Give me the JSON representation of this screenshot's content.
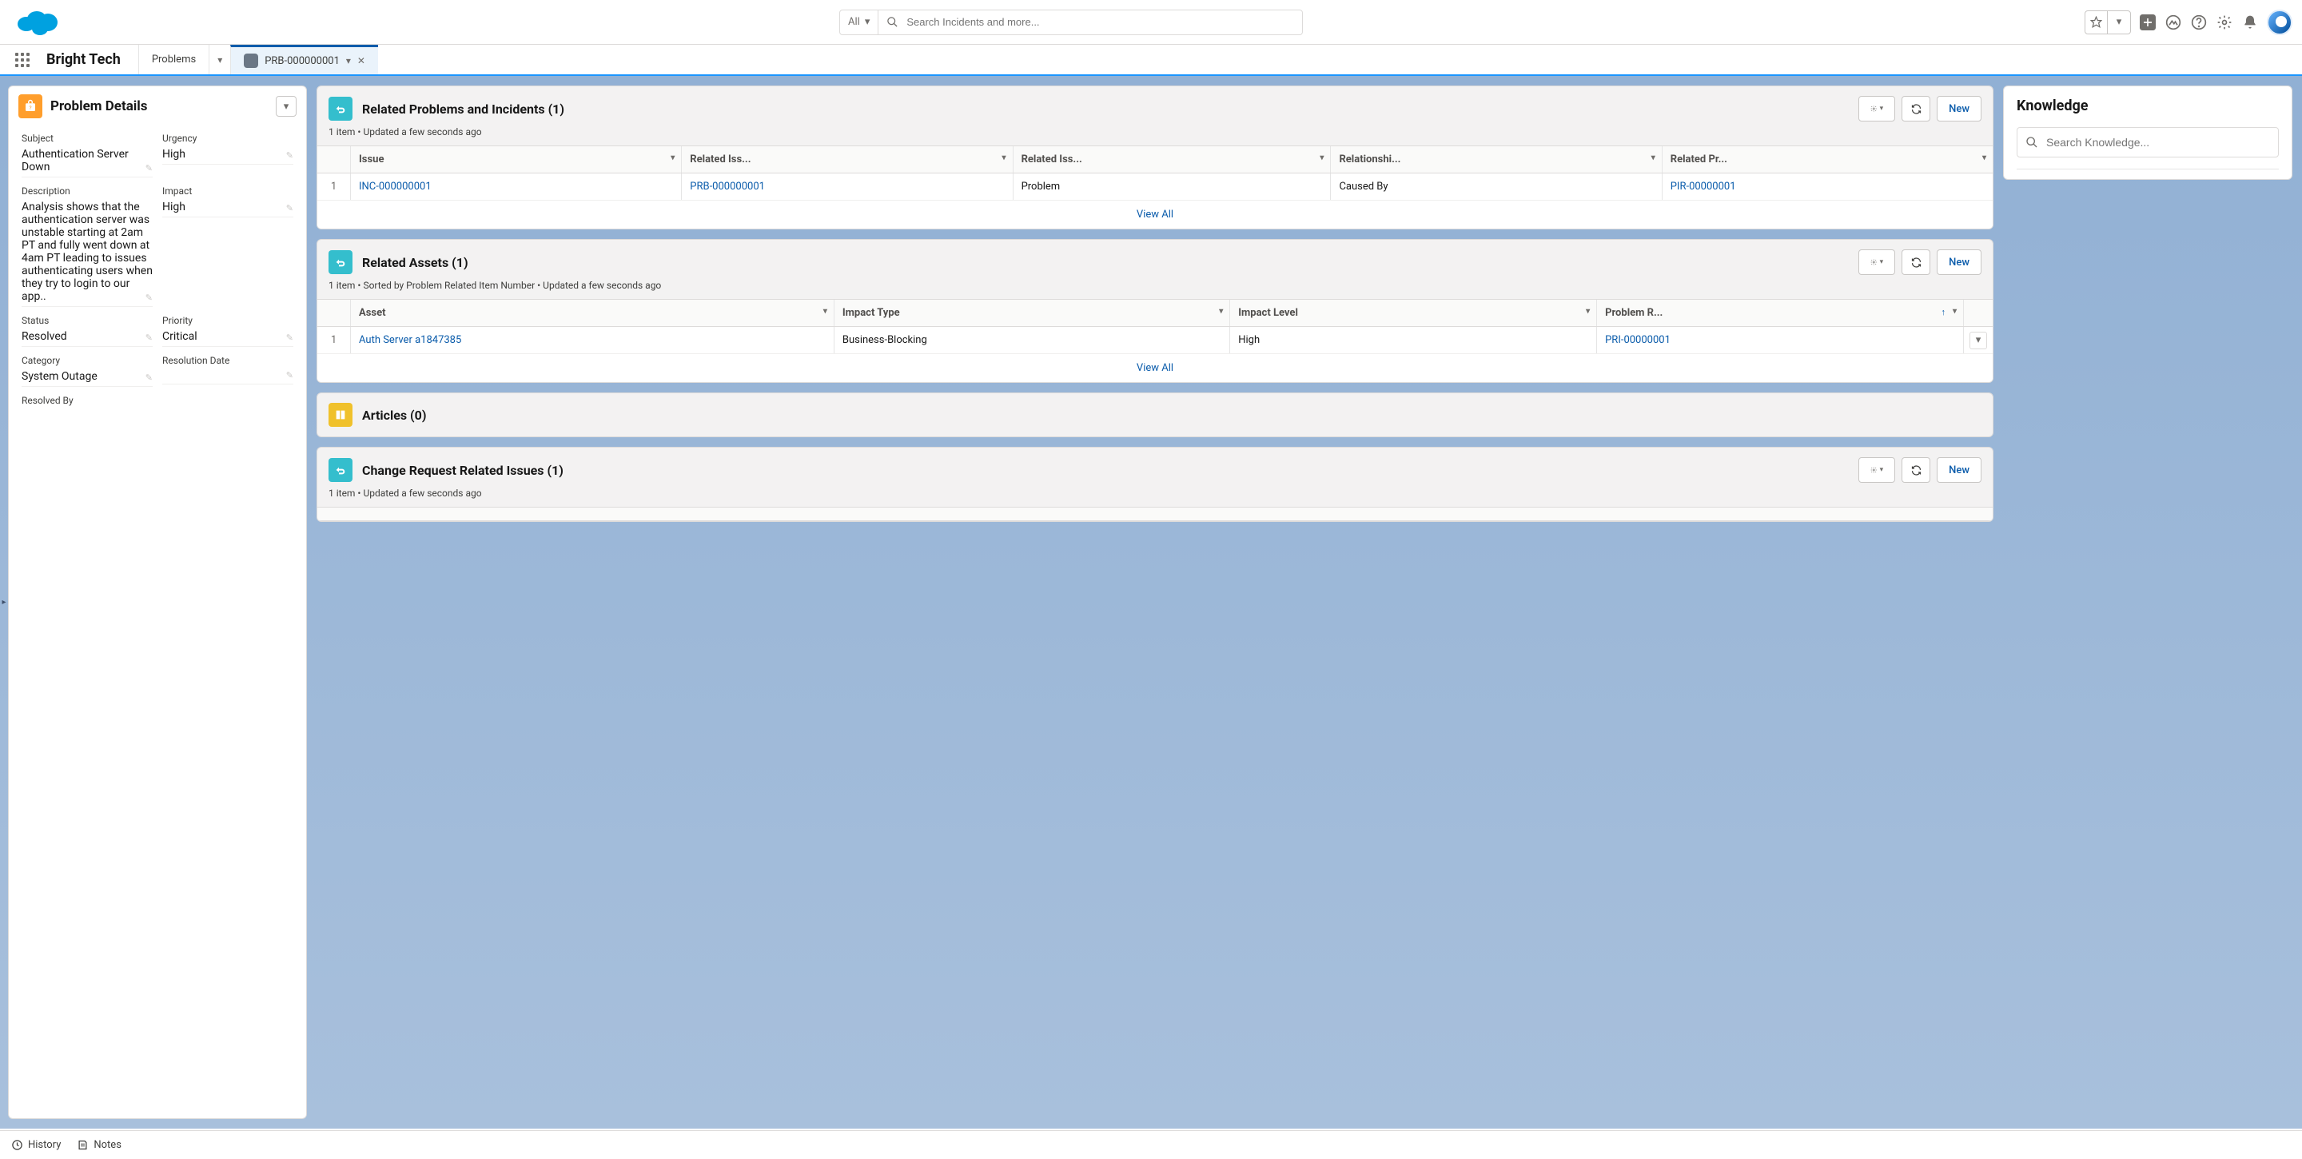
{
  "header": {
    "search_scope": "All",
    "search_placeholder": "Search Incidents and more..."
  },
  "nav": {
    "app_name": "Bright Tech",
    "tabs": [
      {
        "label": "Problems",
        "active": false,
        "chev_only": false
      },
      {
        "label": "PRB-000000001",
        "active": true,
        "closeable": true
      }
    ]
  },
  "problem_details": {
    "title": "Problem Details",
    "fields": {
      "subject_label": "Subject",
      "subject_value": "Authentication Server Down",
      "urgency_label": "Urgency",
      "urgency_value": "High",
      "description_label": "Description",
      "description_value": "Analysis shows that the authentication server was unstable starting at 2am PT and fully went down at 4am PT leading to issues authenticating users when they try to login to our app..",
      "impact_label": "Impact",
      "impact_value": "High",
      "status_label": "Status",
      "status_value": "Resolved",
      "priority_label": "Priority",
      "priority_value": "Critical",
      "category_label": "Category",
      "category_value": "System Outage",
      "resolution_date_label": "Resolution Date",
      "resolution_date_value": "",
      "resolved_by_label": "Resolved By"
    }
  },
  "related": {
    "problems_incidents": {
      "title": "Related Problems and Incidents (1)",
      "subtitle": "1 item • Updated a few seconds ago",
      "new_label": "New",
      "columns": [
        "Issue",
        "Related Iss...",
        "Related Iss...",
        "Relationshi...",
        "Related Pr..."
      ],
      "rows": [
        {
          "num": "1",
          "issue": "INC-000000001",
          "related_issue": "PRB-000000001",
          "related_issue_type": "Problem",
          "relationship": "Caused By",
          "related_pr": "PIR-00000001"
        }
      ],
      "view_all": "View All"
    },
    "assets": {
      "title": "Related Assets (1)",
      "subtitle": "1 item • Sorted by Problem Related Item Number • Updated a few seconds ago",
      "new_label": "New",
      "columns": [
        "Asset",
        "Impact Type",
        "Impact Level",
        "Problem R..."
      ],
      "rows": [
        {
          "num": "1",
          "asset": "Auth Server a1847385",
          "impact_type": "Business-Blocking",
          "impact_level": "High",
          "problem_r": "PRI-00000001"
        }
      ],
      "view_all": "View All"
    },
    "articles": {
      "title": "Articles (0)"
    },
    "change_requests": {
      "title": "Change Request Related Issues (1)",
      "subtitle": "1 item • Updated a few seconds ago",
      "new_label": "New"
    }
  },
  "knowledge": {
    "title": "Knowledge",
    "search_placeholder": "Search Knowledge..."
  },
  "utility": {
    "history": "History",
    "notes": "Notes"
  }
}
